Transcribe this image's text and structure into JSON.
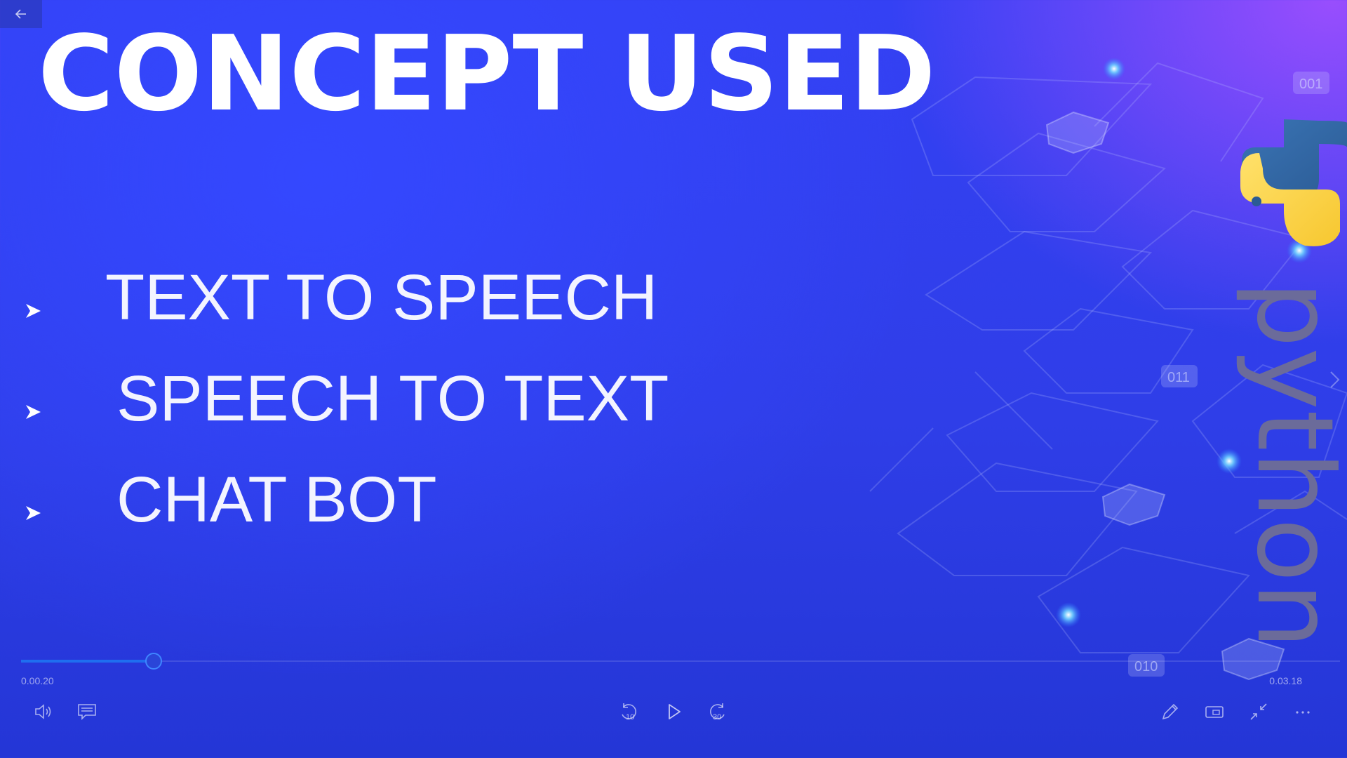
{
  "slide": {
    "title": "CONCEPT USED",
    "items": [
      {
        "label": "TEXT TO SPEECH"
      },
      {
        "label": "SPEECH TO TEXT"
      },
      {
        "label": "CHAT BOT"
      }
    ],
    "logo_wordmark": "python",
    "binary_tags": [
      "001",
      "011",
      "010"
    ]
  },
  "player": {
    "current_time": "0.00.20",
    "total_time": "0.03.18",
    "progress": 0.1,
    "icons": [
      "back-arrow-icon",
      "volume-icon",
      "captions-icon",
      "rewind-10-icon",
      "play-icon",
      "forward-30-icon",
      "pen-icon",
      "cast-icon",
      "exit-fullscreen-icon",
      "more-icon"
    ],
    "rewind_seconds": "10",
    "forward_seconds": "30"
  },
  "colors": {
    "accent": "#1f6ef0",
    "bg_blue": "#3441f4",
    "bg_purple": "#aa50ff"
  }
}
